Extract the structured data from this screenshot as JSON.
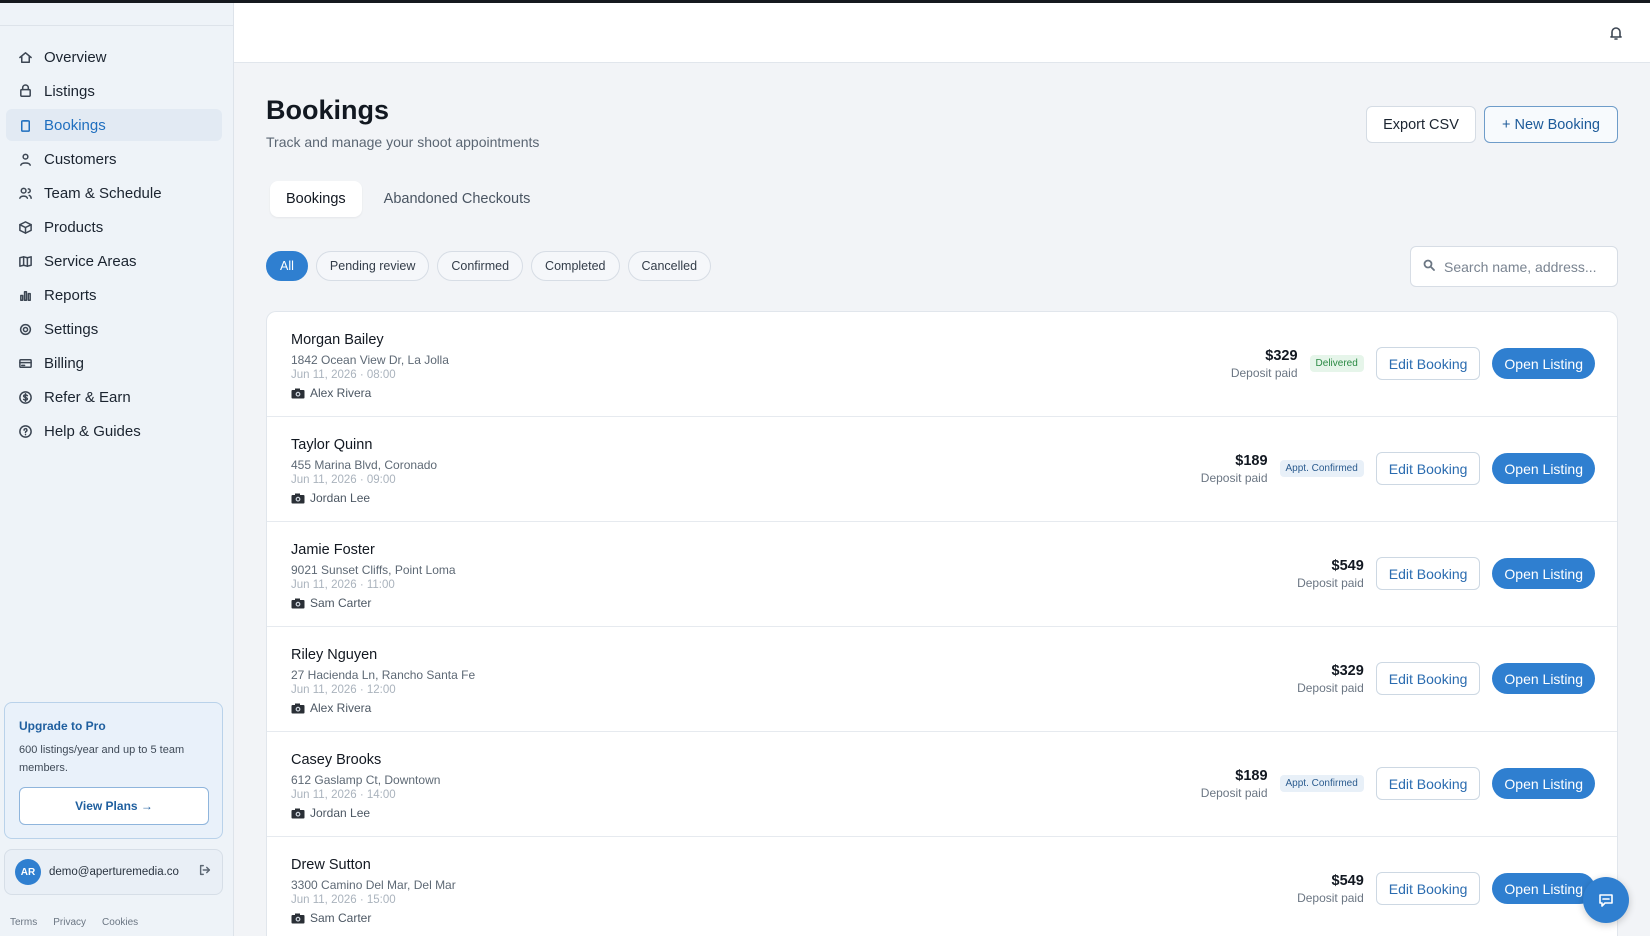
{
  "sidebar": {
    "items": [
      {
        "label": "Overview",
        "icon": "home-icon",
        "active": false
      },
      {
        "label": "Listings",
        "icon": "listings-icon",
        "active": false
      },
      {
        "label": "Bookings",
        "icon": "clipboard-icon",
        "active": true
      },
      {
        "label": "Customers",
        "icon": "user-icon",
        "active": false
      },
      {
        "label": "Team & Schedule",
        "icon": "users-icon",
        "active": false
      },
      {
        "label": "Products",
        "icon": "box-icon",
        "active": false
      },
      {
        "label": "Service Areas",
        "icon": "map-icon",
        "active": false
      },
      {
        "label": "Reports",
        "icon": "bar-chart-icon",
        "active": false
      },
      {
        "label": "Settings",
        "icon": "gear-icon",
        "active": false
      },
      {
        "label": "Billing",
        "icon": "credit-card-icon",
        "active": false
      },
      {
        "label": "Refer & Earn",
        "icon": "dollar-icon",
        "active": false
      },
      {
        "label": "Help & Guides",
        "icon": "help-icon",
        "active": false
      }
    ],
    "upgrade": {
      "title": "Upgrade to Pro",
      "description": "600 listings/year and up to 5 team members.",
      "button": "View Plans →"
    },
    "account": {
      "initials": "AR",
      "email": "demo@aperturemedia.co"
    },
    "footer": [
      "Terms",
      "Privacy",
      "Cookies"
    ]
  },
  "page": {
    "title": "Bookings",
    "subtitle": "Track and manage your shoot appointments",
    "export_label": "Export CSV",
    "new_label": "+ New Booking"
  },
  "tabs": [
    {
      "label": "Bookings",
      "active": true
    },
    {
      "label": "Abandoned Checkouts",
      "active": false
    }
  ],
  "filters": [
    {
      "label": "All",
      "active": true
    },
    {
      "label": "Pending review",
      "active": false
    },
    {
      "label": "Confirmed",
      "active": false
    },
    {
      "label": "Completed",
      "active": false
    },
    {
      "label": "Cancelled",
      "active": false
    }
  ],
  "search": {
    "placeholder": "Search name, address..."
  },
  "bookings": [
    {
      "name": "Morgan Bailey",
      "address": "1842 Ocean View Dr, La Jolla",
      "datetime": "Jun 11, 2026 · 08:00",
      "photographer": "Alex Rivera",
      "price": "$329",
      "price_note": "Deposit paid",
      "status": "Delivered",
      "status_type": "delivered",
      "edit": "Edit Booking",
      "open": "Open Listing"
    },
    {
      "name": "Taylor Quinn",
      "address": "455 Marina Blvd, Coronado",
      "datetime": "Jun 11, 2026 · 09:00",
      "photographer": "Jordan Lee",
      "price": "$189",
      "price_note": "Deposit paid",
      "status": "Appt. Confirmed",
      "status_type": "confirmed",
      "edit": "Edit Booking",
      "open": "Open Listing"
    },
    {
      "name": "Jamie Foster",
      "address": "9021 Sunset Cliffs, Point Loma",
      "datetime": "Jun 11, 2026 · 11:00",
      "photographer": "Sam Carter",
      "price": "$549",
      "price_note": "Deposit paid",
      "status": "",
      "status_type": "",
      "edit": "Edit Booking",
      "open": "Open Listing"
    },
    {
      "name": "Riley Nguyen",
      "address": "27 Hacienda Ln, Rancho Santa Fe",
      "datetime": "Jun 11, 2026 · 12:00",
      "photographer": "Alex Rivera",
      "price": "$329",
      "price_note": "Deposit paid",
      "status": "",
      "status_type": "",
      "edit": "Edit Booking",
      "open": "Open Listing"
    },
    {
      "name": "Casey Brooks",
      "address": "612 Gaslamp Ct, Downtown",
      "datetime": "Jun 11, 2026 · 14:00",
      "photographer": "Jordan Lee",
      "price": "$189",
      "price_note": "Deposit paid",
      "status": "Appt. Confirmed",
      "status_type": "confirmed",
      "edit": "Edit Booking",
      "open": "Open Listing"
    },
    {
      "name": "Drew Sutton",
      "address": "3300 Camino Del Mar, Del Mar",
      "datetime": "Jun 11, 2026 · 15:00",
      "photographer": "Sam Carter",
      "price": "$549",
      "price_note": "Deposit paid",
      "status": "",
      "status_type": "",
      "edit": "Edit Booking",
      "open": "Open Listing"
    }
  ],
  "colors": {
    "accent": "#2f7fd0",
    "sidebar_bg": "#eef3f8",
    "delivered": "#2b8a44"
  }
}
